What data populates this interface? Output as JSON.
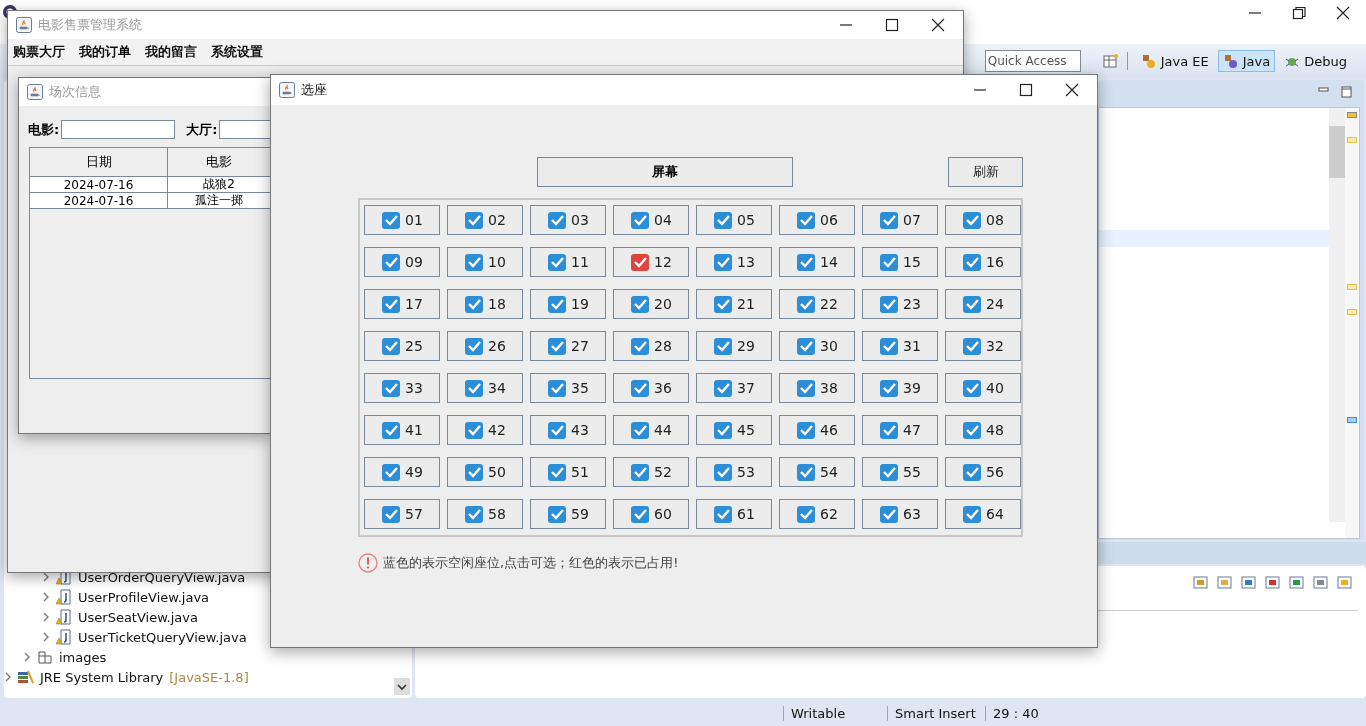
{
  "ide": {
    "quick_access": "Quick Access",
    "perspectives": [
      {
        "label": "Java EE",
        "selected": false
      },
      {
        "label": "Java",
        "selected": true
      },
      {
        "label": "Debug",
        "selected": false
      }
    ],
    "project_tree": [
      {
        "children": [
          {
            "children": [
              {
                "label": "UserOrderQueryView.java"
              },
              {
                "label": "UserProfileView.java"
              },
              {
                "label": "UserSeatView.java"
              },
              {
                "label": "UserTicketQueryView.java"
              }
            ]
          },
          {
            "label": "images",
            "kind": "package"
          }
        ]
      },
      {
        "label": "JRE System Library",
        "suffix": "[JavaSE-1.8]",
        "kind": "library"
      }
    ],
    "status_bar": [
      "Writable",
      "Smart Insert",
      "29 : 40"
    ]
  },
  "app_window": {
    "title": "电影售票管理系统",
    "menu": [
      "购票大厅",
      "我的订单",
      "我的留言",
      "系统设置"
    ]
  },
  "session_frame": {
    "title": "场次信息",
    "filters": [
      "电影:",
      "大厅:"
    ],
    "columns": [
      "日期",
      "电影"
    ],
    "rows": [
      [
        "2024-07-16",
        "战狼2"
      ],
      [
        "2024-07-16",
        "孤注一掷"
      ]
    ]
  },
  "seat_dialog": {
    "title": "选座",
    "screen_label": "屏幕",
    "refresh_label": "刷新",
    "seats": [
      {
        "label": "01",
        "occupied": false
      },
      {
        "label": "02",
        "occupied": false
      },
      {
        "label": "03",
        "occupied": false
      },
      {
        "label": "04",
        "occupied": false
      },
      {
        "label": "05",
        "occupied": false
      },
      {
        "label": "06",
        "occupied": false
      },
      {
        "label": "07",
        "occupied": false
      },
      {
        "label": "08",
        "occupied": false
      },
      {
        "label": "09",
        "occupied": false
      },
      {
        "label": "10",
        "occupied": false
      },
      {
        "label": "11",
        "occupied": false
      },
      {
        "label": "12",
        "occupied": true
      },
      {
        "label": "13",
        "occupied": false
      },
      {
        "label": "14",
        "occupied": false
      },
      {
        "label": "15",
        "occupied": false
      },
      {
        "label": "16",
        "occupied": false
      },
      {
        "label": "17",
        "occupied": false
      },
      {
        "label": "18",
        "occupied": false
      },
      {
        "label": "19",
        "occupied": false
      },
      {
        "label": "20",
        "occupied": false
      },
      {
        "label": "21",
        "occupied": false
      },
      {
        "label": "22",
        "occupied": false
      },
      {
        "label": "23",
        "occupied": false
      },
      {
        "label": "24",
        "occupied": false
      },
      {
        "label": "25",
        "occupied": false
      },
      {
        "label": "26",
        "occupied": false
      },
      {
        "label": "27",
        "occupied": false
      },
      {
        "label": "28",
        "occupied": false
      },
      {
        "label": "29",
        "occupied": false
      },
      {
        "label": "30",
        "occupied": false
      },
      {
        "label": "31",
        "occupied": false
      },
      {
        "label": "32",
        "occupied": false
      },
      {
        "label": "33",
        "occupied": false
      },
      {
        "label": "34",
        "occupied": false
      },
      {
        "label": "35",
        "occupied": false
      },
      {
        "label": "36",
        "occupied": false
      },
      {
        "label": "37",
        "occupied": false
      },
      {
        "label": "38",
        "occupied": false
      },
      {
        "label": "39",
        "occupied": false
      },
      {
        "label": "40",
        "occupied": false
      },
      {
        "label": "41",
        "occupied": false
      },
      {
        "label": "42",
        "occupied": false
      },
      {
        "label": "43",
        "occupied": false
      },
      {
        "label": "44",
        "occupied": false
      },
      {
        "label": "45",
        "occupied": false
      },
      {
        "label": "46",
        "occupied": false
      },
      {
        "label": "47",
        "occupied": false
      },
      {
        "label": "48",
        "occupied": false
      },
      {
        "label": "49",
        "occupied": false
      },
      {
        "label": "50",
        "occupied": false
      },
      {
        "label": "51",
        "occupied": false
      },
      {
        "label": "52",
        "occupied": false
      },
      {
        "label": "53",
        "occupied": false
      },
      {
        "label": "54",
        "occupied": false
      },
      {
        "label": "55",
        "occupied": false
      },
      {
        "label": "56",
        "occupied": false
      },
      {
        "label": "57",
        "occupied": false
      },
      {
        "label": "58",
        "occupied": false
      },
      {
        "label": "59",
        "occupied": false
      },
      {
        "label": "60",
        "occupied": false
      },
      {
        "label": "61",
        "occupied": false
      },
      {
        "label": "62",
        "occupied": false
      },
      {
        "label": "63",
        "occupied": false
      },
      {
        "label": "64",
        "occupied": false
      }
    ],
    "notice": "蓝色的表示空闲座位,点击可选；红色的表示已占用!"
  }
}
